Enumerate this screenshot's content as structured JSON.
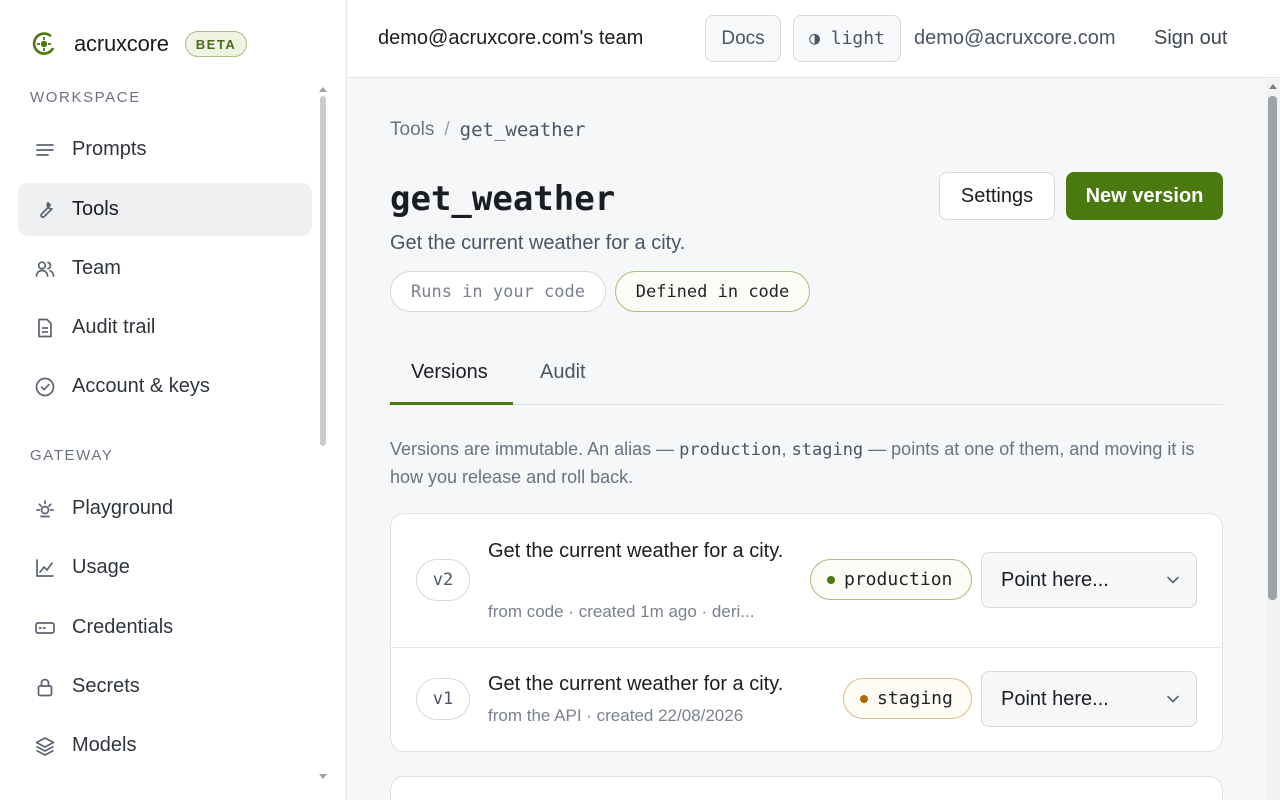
{
  "brand": {
    "name": "acruxcore",
    "badge": "BETA",
    "logo_icon": "target-logo-icon",
    "accent": "#4a7a0f"
  },
  "sidebar": {
    "sections": [
      {
        "label": "WORKSPACE",
        "items": [
          {
            "label": "Prompts",
            "icon": "lines-icon",
            "active": false
          },
          {
            "label": "Tools",
            "icon": "wrench-icon",
            "active": true
          },
          {
            "label": "Team",
            "icon": "users-icon",
            "active": false
          },
          {
            "label": "Audit trail",
            "icon": "document-icon",
            "active": false
          },
          {
            "label": "Account & keys",
            "icon": "check-circle-icon",
            "active": false
          }
        ]
      },
      {
        "label": "GATEWAY",
        "items": [
          {
            "label": "Playground",
            "icon": "sun-icon",
            "active": false
          },
          {
            "label": "Usage",
            "icon": "chart-line-icon",
            "active": false
          },
          {
            "label": "Credentials",
            "icon": "card-icon",
            "active": false
          },
          {
            "label": "Secrets",
            "icon": "lock-icon",
            "active": false
          },
          {
            "label": "Models",
            "icon": "layers-icon",
            "active": false
          }
        ]
      }
    ]
  },
  "topbar": {
    "team": "demo@acruxcore.com's team",
    "docs": "Docs",
    "theme": "◑ light",
    "email": "demo@acruxcore.com",
    "signout": "Sign out"
  },
  "breadcrumb": {
    "parent": "Tools",
    "separator": "/",
    "current": "get_weather"
  },
  "tool": {
    "name": "get_weather",
    "description": "Get the current weather for a city.",
    "chips": [
      "Runs in your code",
      "Defined in code"
    ],
    "settings_label": "Settings",
    "new_version_label": "New version"
  },
  "tabs": [
    {
      "label": "Versions",
      "active": true
    },
    {
      "label": "Audit",
      "active": false
    }
  ],
  "note": {
    "part1": "Versions are immutable. An alias — ",
    "code1": "production",
    "comma": ", ",
    "code2": "staging",
    "part2": " — points at one of them, and moving it is how you release and roll back."
  },
  "versions": [
    {
      "tag": "v2",
      "title": "Get the current weather for a city.",
      "meta": "from code · created 1m ago · deri...",
      "alias": "production",
      "alias_color": "#4a7a0f",
      "select": "Point here..."
    },
    {
      "tag": "v1",
      "title": "Get the current weather for a city.",
      "meta": "from the API · created 22/08/2026",
      "alias": "staging",
      "alias_color": "#a86d00",
      "select": "Point here..."
    }
  ]
}
